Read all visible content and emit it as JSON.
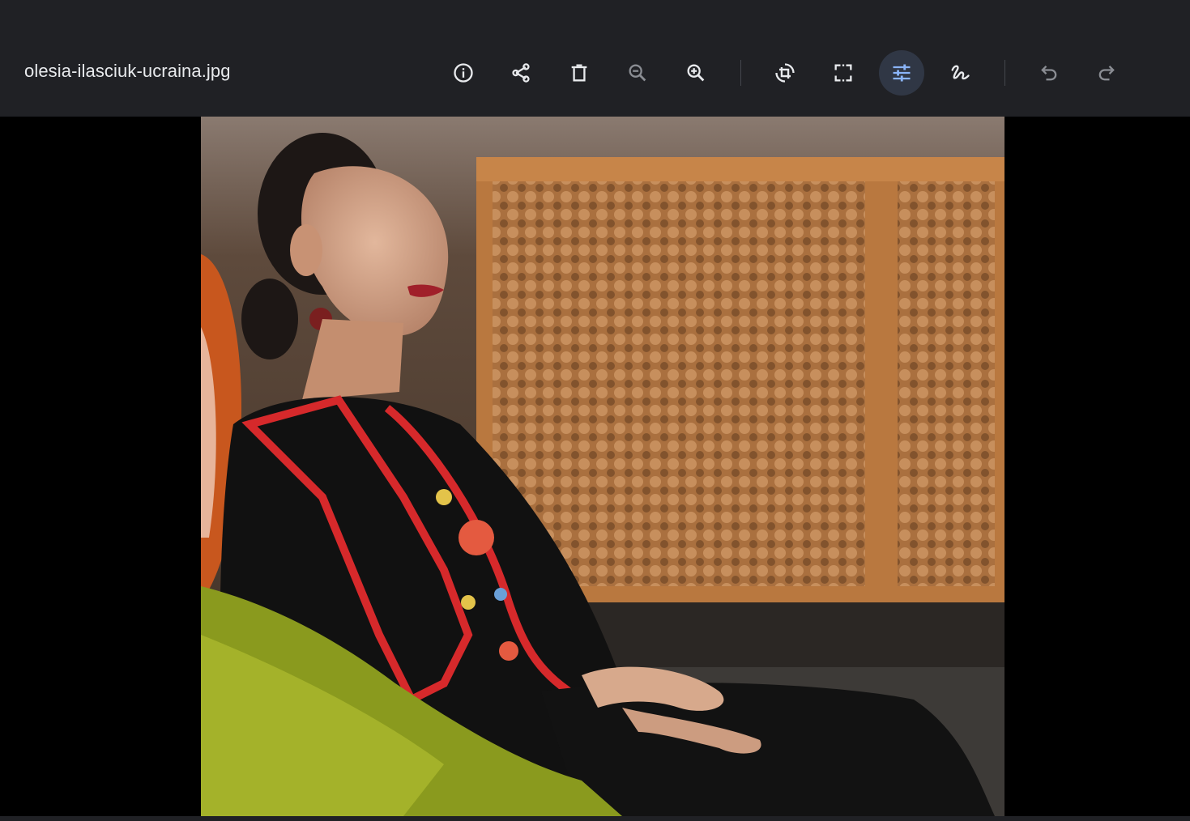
{
  "header": {
    "filename": "olesia-ilasciuk-ucraina.jpg"
  },
  "toolbar": {
    "icon_color": "#e8eaed",
    "disabled_color": "#8a8d93",
    "active_color": "#8ab4f8",
    "active_background": "#303745",
    "buttons": [
      {
        "name": "info-button",
        "icon": "info-icon",
        "state": "enabled"
      },
      {
        "name": "share-button",
        "icon": "share-icon",
        "state": "enabled"
      },
      {
        "name": "delete-button",
        "icon": "trash-icon",
        "state": "enabled"
      },
      {
        "name": "zoom-out-button",
        "icon": "zoom-out-icon",
        "state": "disabled"
      },
      {
        "name": "zoom-in-button",
        "icon": "zoom-in-icon",
        "state": "enabled"
      },
      {
        "name": "rotate-button",
        "icon": "rotate-crop-icon",
        "state": "enabled"
      },
      {
        "name": "crop-button",
        "icon": "crop-icon",
        "state": "enabled"
      },
      {
        "name": "adjust-button",
        "icon": "tune-icon",
        "state": "active"
      },
      {
        "name": "markup-button",
        "icon": "draw-icon",
        "state": "enabled"
      },
      {
        "name": "undo-button",
        "icon": "undo-icon",
        "state": "disabled"
      },
      {
        "name": "redo-button",
        "icon": "redo-icon",
        "state": "disabled"
      }
    ]
  },
  "image": {
    "subject": "photo"
  }
}
